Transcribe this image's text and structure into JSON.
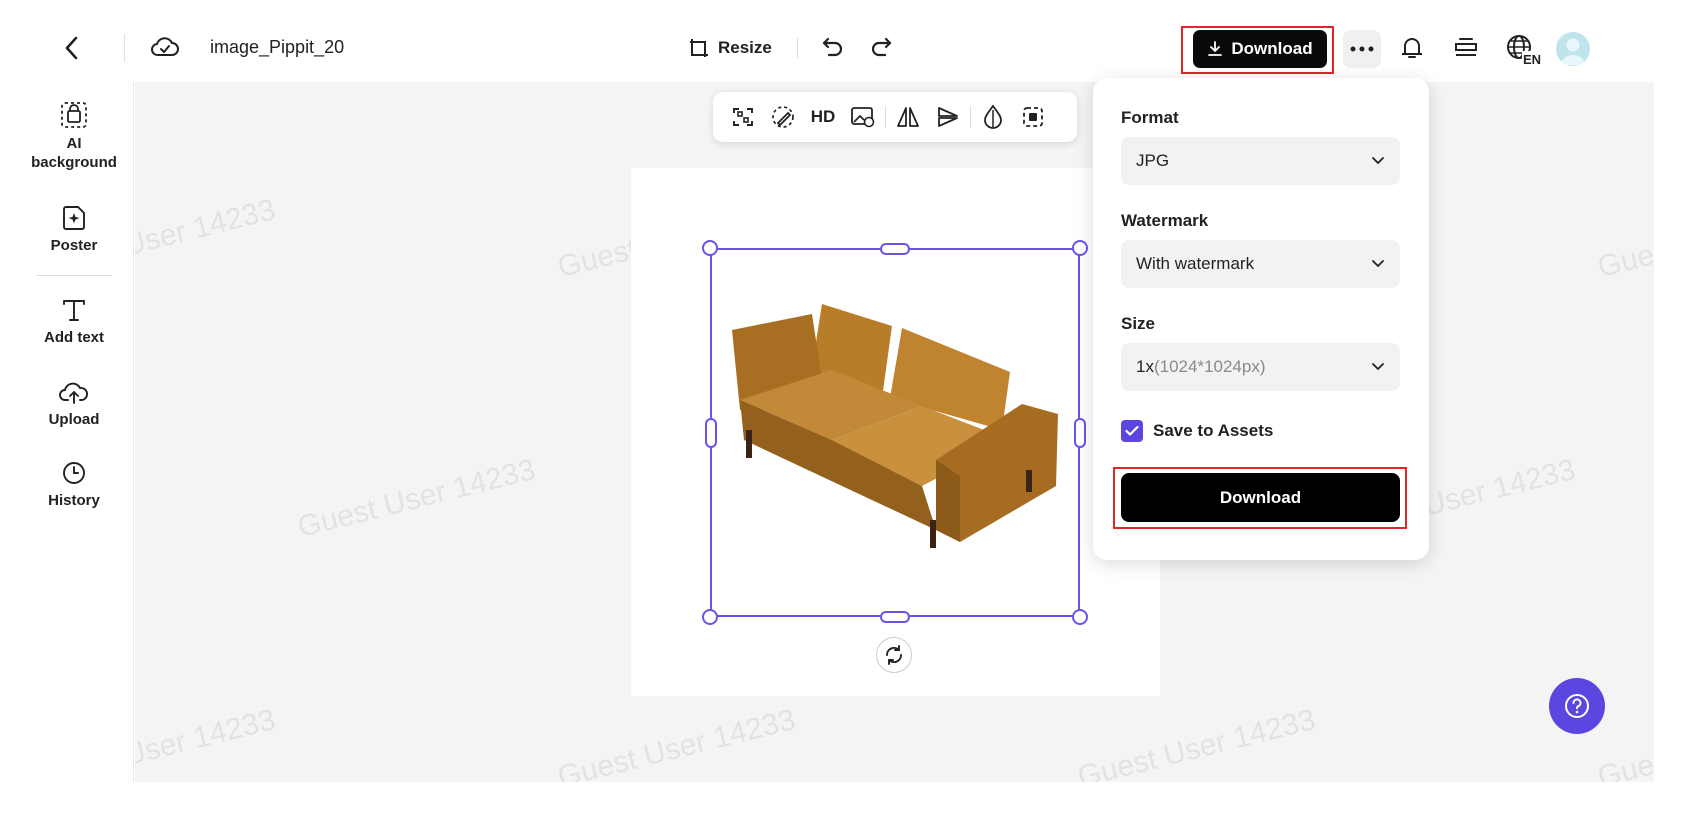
{
  "app": {
    "file_name": "image_Pippit_20",
    "colors": {
      "accent": "#5b47e0",
      "selection": "#6655e6",
      "highlight": "#e0252d"
    }
  },
  "topbar": {
    "resize_label": "Resize",
    "download_label": "Download",
    "language_badge": "EN",
    "icons": [
      "chevron-left-icon",
      "cloud-icon",
      "resize-icon",
      "undo-icon",
      "redo-icon",
      "download-icon",
      "more-icon",
      "bell-icon",
      "layers-icon",
      "globe-icon",
      "avatar"
    ]
  },
  "sidebar": {
    "items": [
      {
        "label": "AI\nbackground",
        "icon": "ai-background-icon"
      },
      {
        "label": "Poster",
        "icon": "poster-icon"
      },
      {
        "label": "Add text",
        "icon": "text-icon"
      },
      {
        "label": "Upload",
        "icon": "upload-cloud-icon"
      },
      {
        "label": "History",
        "icon": "clock-icon"
      }
    ]
  },
  "image_toolbar": {
    "hd_label": "HD",
    "icons": [
      "cutout-icon",
      "magic-eraser-icon",
      "hd-icon",
      "image-replace-icon",
      "flip-horizontal-icon",
      "flip-vertical-icon",
      "opacity-icon",
      "focus-icon"
    ]
  },
  "watermark_text": "Guest User 14233",
  "download_panel": {
    "format_label": "Format",
    "format_value": "JPG",
    "watermark_label": "Watermark",
    "watermark_value": "With watermark",
    "size_label": "Size",
    "size_value": "1x",
    "size_detail": "(1024*1024px)",
    "save_label": "Save to Assets",
    "save_checked": true,
    "download_label": "Download"
  }
}
